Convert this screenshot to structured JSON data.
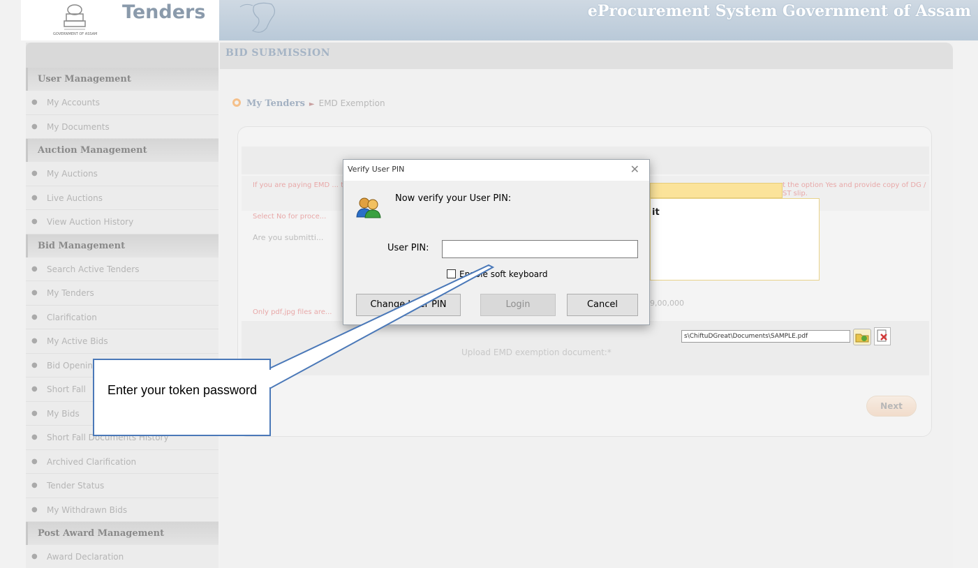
{
  "header": {
    "brand": "Tenders",
    "logo_caption": "GOVERNMENT OF ASSAM",
    "system_title": "eProcurement System Government of Assam"
  },
  "tab": {
    "title": "BID SUBMISSION"
  },
  "sidebar": {
    "sections": [
      {
        "title": "User Management",
        "items": [
          "My Accounts",
          "My Documents"
        ]
      },
      {
        "title": "Auction Management",
        "items": [
          "My Auctions",
          "Live Auctions",
          "View Auction History"
        ]
      },
      {
        "title": "Bid Management",
        "items": [
          "Search Active Tenders",
          "My Tenders",
          "Clarification",
          "My Active Bids",
          "Bid Opening",
          "Short Fall",
          "My Bids",
          "Short Fall Documents History",
          "Archived Clarification",
          "Tender Status",
          "My Withdrawn Bids"
        ]
      },
      {
        "title": "Post Award Management",
        "items": [
          "Award Declaration"
        ]
      }
    ]
  },
  "breadcrumb": {
    "root": "My Tenders",
    "separator": "►",
    "current": "EMD Exemption"
  },
  "form": {
    "info_text": "If you are paying EMD ... the details. For subm...",
    "info_text_right": "t the option Yes and provide copy of DG / ST slip.",
    "select_no_text": "Select No for proce...",
    "question": "Are you submitti...",
    "options_text": "it",
    "only_files_text": "Only pdf,jpg files are...",
    "amount_value": "9,00,000",
    "upload_label": "Upload EMD exemption document:*",
    "file_path": "s\\ChiftuDGreat\\Documents\\SAMPLE.pdf",
    "next_label": "Next"
  },
  "dialog": {
    "title": "Verify User PIN",
    "close_glyph": "✕",
    "prompt": "Now verify your User PIN:",
    "pin_label": "User PIN:",
    "pin_value": "",
    "soft_keyboard_label": "Enable soft keyboard",
    "soft_keyboard_checked": false,
    "change_pin_label": "Change User PIN",
    "login_label": "Login",
    "cancel_label": "Cancel"
  },
  "callout": {
    "text": "Enter your token password"
  },
  "colors": {
    "accent_blue": "#b9c9d8",
    "callout_line": "#4a78b8",
    "highlight_yellow": "#fbe39a"
  }
}
